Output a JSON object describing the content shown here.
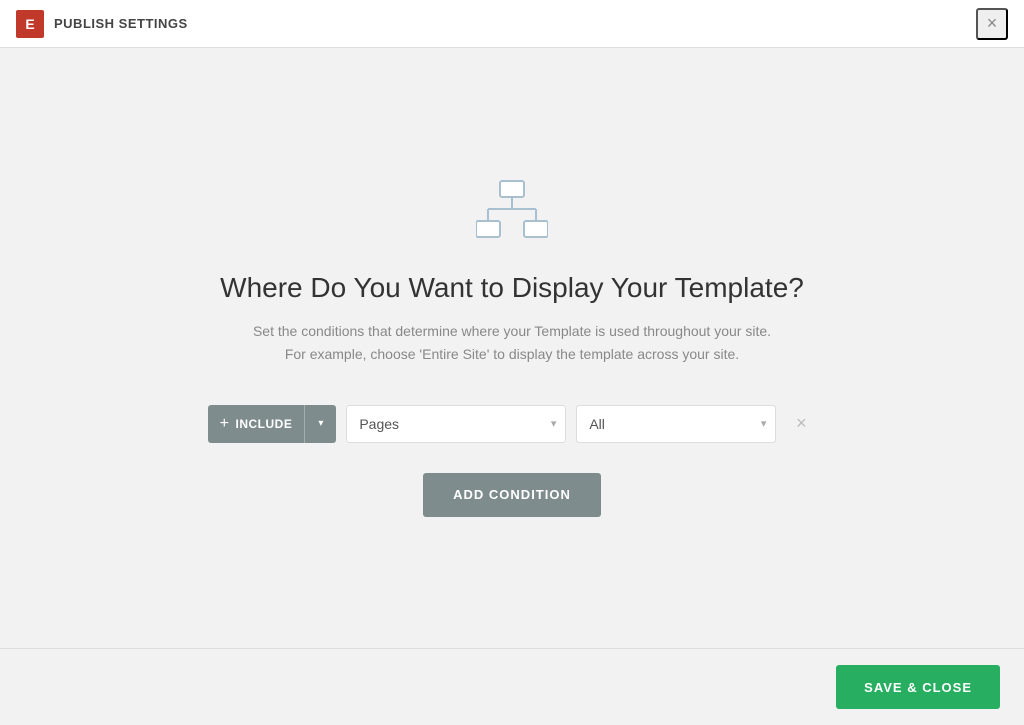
{
  "titlebar": {
    "logo_text": "E",
    "title": "PUBLISH SETTINGS",
    "close_label": "×"
  },
  "main": {
    "heading": "Where Do You Want to Display Your Template?",
    "subtext_line1": "Set the conditions that determine where your Template is used throughout your site.",
    "subtext_line2": "For example, choose 'Entire Site' to display the template across your site.",
    "include_label": "INCLUDE",
    "pages_option": "Pages",
    "all_option": "All",
    "add_condition_label": "ADD CONDITION"
  },
  "footer": {
    "save_close_label": "SAVE & CLOSE"
  },
  "icons": {
    "plus": "+",
    "dropdown_arrow": "▾",
    "close_x": "×",
    "remove_x": "×"
  }
}
